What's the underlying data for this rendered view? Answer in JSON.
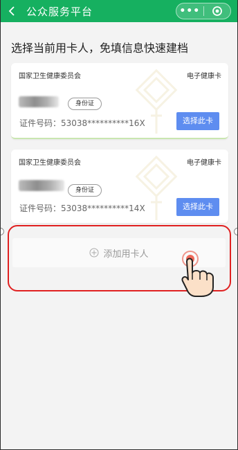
{
  "header": {
    "title": "公众服务平台",
    "bg_color": "#16b060"
  },
  "main": {
    "prompt": "选择当前用卡人，免填信息快速建档",
    "cards": [
      {
        "issuer": "国家卫生健康委员会",
        "card_type": "电子健康卡",
        "id_type": "身份证",
        "id_line": "证件号码：53038**********16X",
        "button": "选择此卡"
      },
      {
        "issuer": "国家卫生健康委员会",
        "card_type": "电子健康卡",
        "id_type": "身份证",
        "id_line": "证件号码：53038**********14X",
        "button": "选择此卡"
      }
    ],
    "add_label": "添加用卡人"
  },
  "colors": {
    "accent_button": "#5e8df0",
    "highlight": "#e02020"
  }
}
